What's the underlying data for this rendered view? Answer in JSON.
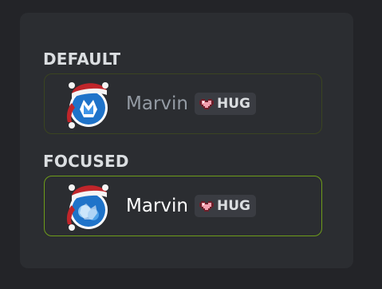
{
  "sections": [
    {
      "label": "DEFAULT",
      "user": {
        "name": "Marvin",
        "avatar_icon": "santa-hat-avatar-icon"
      },
      "tag": {
        "icon": "pixel-heart-icon",
        "text": "HUG"
      }
    },
    {
      "label": "FOCUSED",
      "user": {
        "name": "Marvin",
        "avatar_icon": "santa-hat-avatar-icon"
      },
      "tag": {
        "icon": "pixel-heart-icon",
        "text": "HUG"
      }
    }
  ],
  "colors": {
    "background": "#232428",
    "panel": "#2b2d31",
    "default_border": "#3a4420",
    "focused_border": "#6e9c1a",
    "label_text": "#dbdee1",
    "default_name": "#949ba4",
    "focused_name": "#ffffff",
    "tag_background": "#3a3c42",
    "heart": "#f3a0b0"
  }
}
